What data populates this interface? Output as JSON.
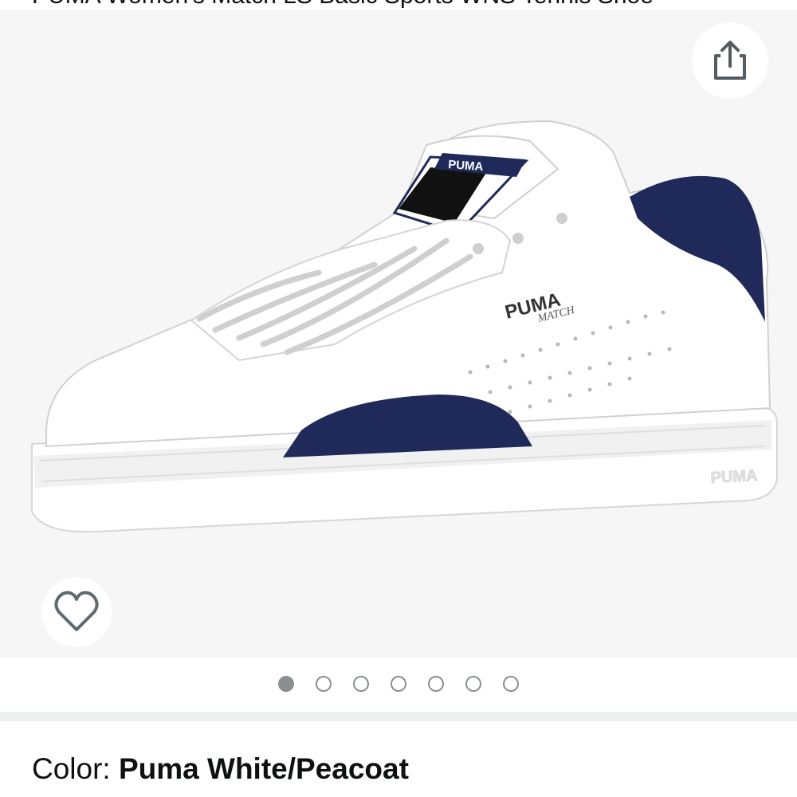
{
  "header": {
    "product_title": "PUMA Women's Match LS Basic Sports WNS Tennis Shoe"
  },
  "gallery": {
    "image_alt": "PUMA Match low-top white leather sneaker with navy peacoat heel and toe accents",
    "image_count": 7,
    "active_index": 0,
    "shoe_logo_text": "PUMA",
    "shoe_model_text": "MATCH",
    "colors": {
      "background": "#f6f6f6",
      "leather": "#ffffff",
      "peacoat": "#1f2a5a",
      "dot": "#8a8f91"
    }
  },
  "actions": {
    "share_icon": "share-icon",
    "wishlist_icon": "heart-outline-icon"
  },
  "variation": {
    "label": "Color: ",
    "value": "Puma White/Peacoat"
  }
}
